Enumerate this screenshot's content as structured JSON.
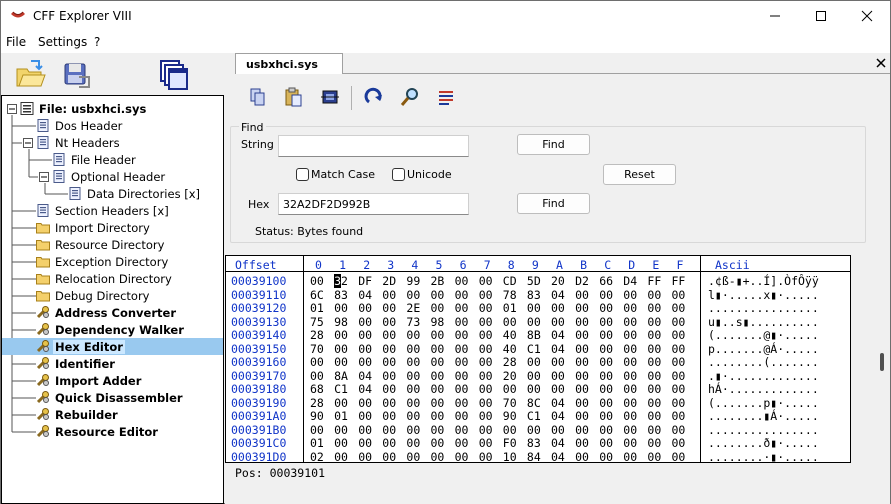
{
  "window": {
    "title": "CFF Explorer VIII"
  },
  "menu": [
    "File",
    "Settings",
    "?"
  ],
  "tree": {
    "root": "File: usbxhci.sys",
    "items": [
      {
        "label": "Dos Header",
        "level": 2,
        "icon": "page-icon"
      },
      {
        "label": "Nt Headers",
        "level": 2,
        "icon": "page-icon"
      },
      {
        "label": "File Header",
        "level": 3,
        "icon": "page-icon"
      },
      {
        "label": "Optional Header",
        "level": 3,
        "icon": "page-icon"
      },
      {
        "label": "Data Directories [x]",
        "level": 4,
        "icon": "page-icon"
      },
      {
        "label": "Section Headers [x]",
        "level": 2,
        "icon": "page-icon"
      },
      {
        "label": "Import Directory",
        "level": 2,
        "icon": "folder-icon"
      },
      {
        "label": "Resource Directory",
        "level": 2,
        "icon": "folder-icon"
      },
      {
        "label": "Exception Directory",
        "level": 2,
        "icon": "folder-icon"
      },
      {
        "label": "Relocation Directory",
        "level": 2,
        "icon": "folder-icon"
      },
      {
        "label": "Debug Directory",
        "level": 2,
        "icon": "folder-icon"
      },
      {
        "label": "Address Converter",
        "level": 2,
        "icon": "tool-icon"
      },
      {
        "label": "Dependency Walker",
        "level": 2,
        "icon": "tool-icon"
      },
      {
        "label": "Hex Editor",
        "level": 2,
        "icon": "tool-icon"
      },
      {
        "label": "Identifier",
        "level": 2,
        "icon": "tool-icon"
      },
      {
        "label": "Import Adder",
        "level": 2,
        "icon": "tool-icon"
      },
      {
        "label": "Quick Disassembler",
        "level": 2,
        "icon": "tool-icon"
      },
      {
        "label": "Rebuilder",
        "level": 2,
        "icon": "tool-icon"
      },
      {
        "label": "Resource Editor",
        "level": 2,
        "icon": "tool-icon"
      }
    ],
    "selected": "Hex Editor"
  },
  "tab": {
    "label": "usbxhci.sys"
  },
  "find": {
    "legend": "Find",
    "string_label": "String",
    "string_value": "",
    "find_button": "Find",
    "match_case": "Match Case",
    "unicode": "Unicode",
    "reset_button": "Reset",
    "hex_label": "Hex",
    "hex_value": "32A2DF2D992B",
    "find_hex_button": "Find",
    "status": "Status: Bytes found"
  },
  "hex": {
    "offset_header": "Offset",
    "columns": [
      "0",
      "1",
      "2",
      "3",
      "4",
      "5",
      "6",
      "7",
      "8",
      "9",
      "A",
      "B",
      "C",
      "D",
      "E",
      "F"
    ],
    "ascii_header": "Ascii",
    "rows": [
      {
        "offset": "00039100",
        "bytes": "00 32 DF 2D 99 2B 00 00 CD 5D 20 D2 66 D4 FF FF",
        "ascii": ".¢ß-▮+..Í].ÒfÔÿÿ"
      },
      {
        "offset": "00039110",
        "bytes": "6C 83 04 00 00 00 00 00 78 83 04 00 00 00 00 00",
        "ascii": "l▮·.....x▮·....."
      },
      {
        "offset": "00039120",
        "bytes": "01 00 00 00 2E 00 00 00 01 00 00 00 00 00 00 00",
        "ascii": "................"
      },
      {
        "offset": "00039130",
        "bytes": "75 98 00 00 73 98 00 00 00 00 00 00 00 00 00 00",
        "ascii": "u▮..s▮.........."
      },
      {
        "offset": "00039140",
        "bytes": "28 00 00 00 00 00 00 00 40 8B 04 00 00 00 00 00",
        "ascii": "(.......@▮·....."
      },
      {
        "offset": "00039150",
        "bytes": "70 00 00 00 00 00 00 00 40 C1 04 00 00 00 00 00",
        "ascii": "p.......@Á·....."
      },
      {
        "offset": "00039160",
        "bytes": "00 00 00 00 00 00 00 00 28 00 00 00 00 00 00 00",
        "ascii": "........(......."
      },
      {
        "offset": "00039170",
        "bytes": "00 8A 04 00 00 00 00 00 20 00 00 00 00 00 00 00",
        "ascii": ".▮·............."
      },
      {
        "offset": "00039180",
        "bytes": "68 C1 04 00 00 00 00 00 00 00 00 00 00 00 00 00",
        "ascii": "hÁ·............."
      },
      {
        "offset": "00039190",
        "bytes": "28 00 00 00 00 00 00 00 70 8C 04 00 00 00 00 00",
        "ascii": "(.......p▮·....."
      },
      {
        "offset": "000391A0",
        "bytes": "90 01 00 00 00 00 00 00 90 C1 04 00 00 00 00 00",
        "ascii": "........▮Á·....."
      },
      {
        "offset": "000391B0",
        "bytes": "00 00 00 00 00 00 00 00 00 00 00 00 00 00 00 00",
        "ascii": "................"
      },
      {
        "offset": "000391C0",
        "bytes": "01 00 00 00 00 00 00 00 F0 83 04 00 00 00 00 00",
        "ascii": "........ð▮·....."
      },
      {
        "offset": "000391D0",
        "bytes": "02 00 00 00 00 00 00 00 10 84 04 00 00 00 00 00",
        "ascii": "........·▮·....."
      }
    ]
  },
  "position": "Pos: 00039101"
}
